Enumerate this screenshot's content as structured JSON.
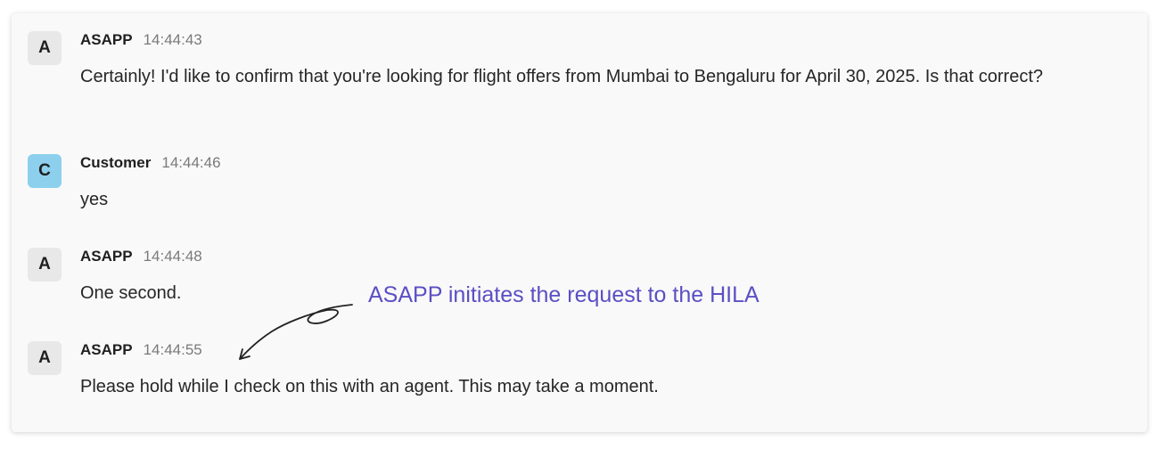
{
  "messages": [
    {
      "avatar": "A",
      "sender": "ASAPP",
      "time": "14:44:43",
      "text": "Certainly! I'd like to confirm that you're looking for flight offers from Mumbai to Bengaluru for April 30, 2025. Is that correct?"
    },
    {
      "avatar": "C",
      "sender": "Customer",
      "time": "14:44:46",
      "text": "yes"
    },
    {
      "avatar": "A",
      "sender": "ASAPP",
      "time": "14:44:48",
      "text": "One second."
    },
    {
      "avatar": "A",
      "sender": "ASAPP",
      "time": "14:44:55",
      "text": "Please hold while I check on this with an agent. This may take a moment."
    }
  ],
  "annotation": {
    "text": "ASAPP initiates the request to the HILA",
    "color": "#5a4fc4"
  },
  "colors": {
    "customer_avatar": "#8cd0ee",
    "asapp_avatar": "#e8e8e8"
  }
}
